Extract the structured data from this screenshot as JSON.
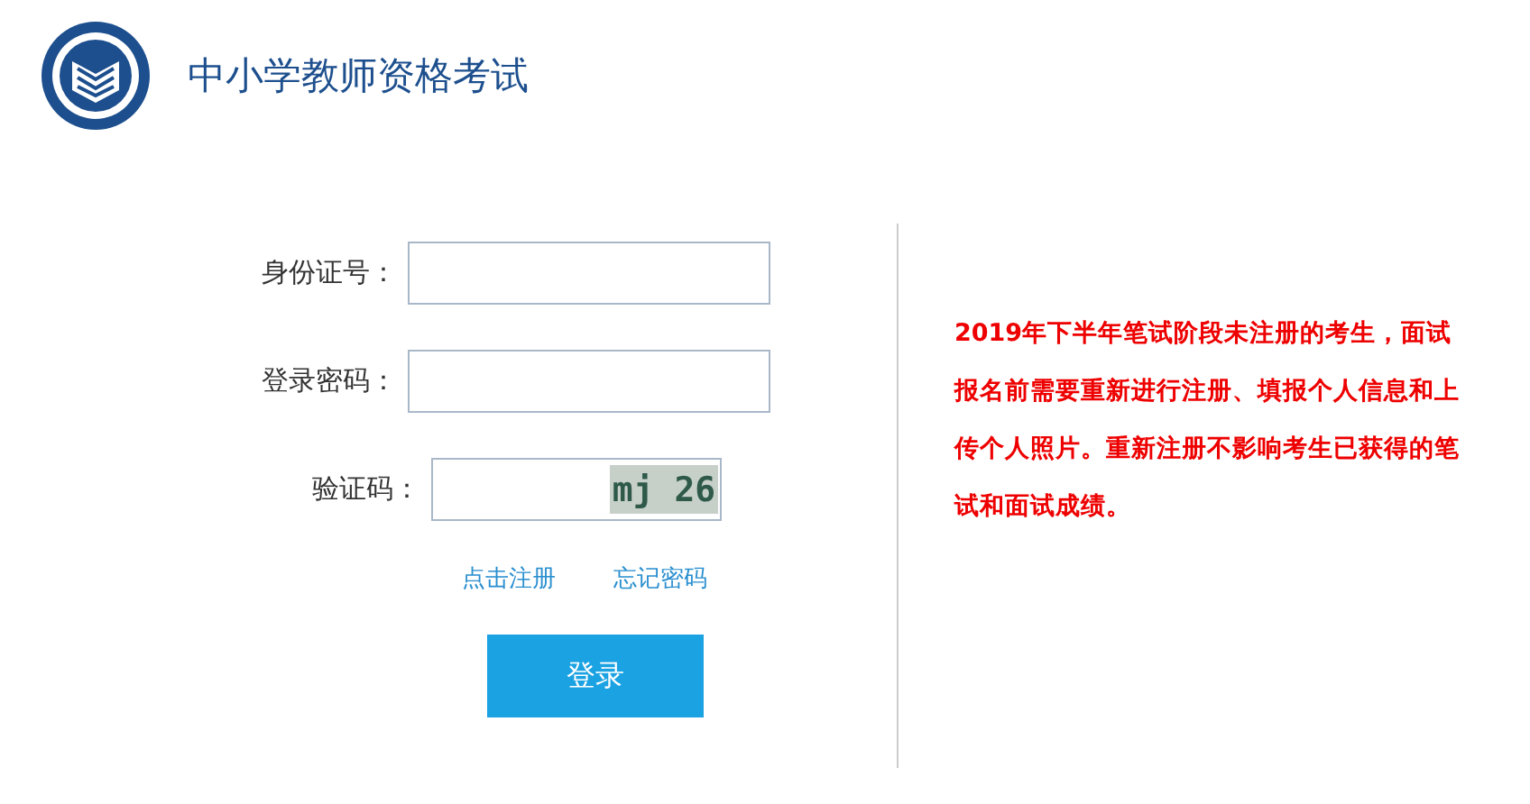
{
  "header": {
    "title": "中小学教师资格考试"
  },
  "form": {
    "fields": [
      {
        "kind": "text",
        "label": "身份证号："
      },
      {
        "kind": "password",
        "label": "登录密码："
      },
      {
        "kind": "captcha",
        "label": "验证码：",
        "captcha": "mj 26"
      }
    ],
    "links": [
      "点击注册",
      "忘记密码"
    ],
    "submit": "登录"
  },
  "notice": "2019年下半年笔试阶段未注册的考生，面试报名前需要重新进行注册、填报个人信息和上传个人照片。重新注册不影响考生已获得的笔试和面试成绩。"
}
